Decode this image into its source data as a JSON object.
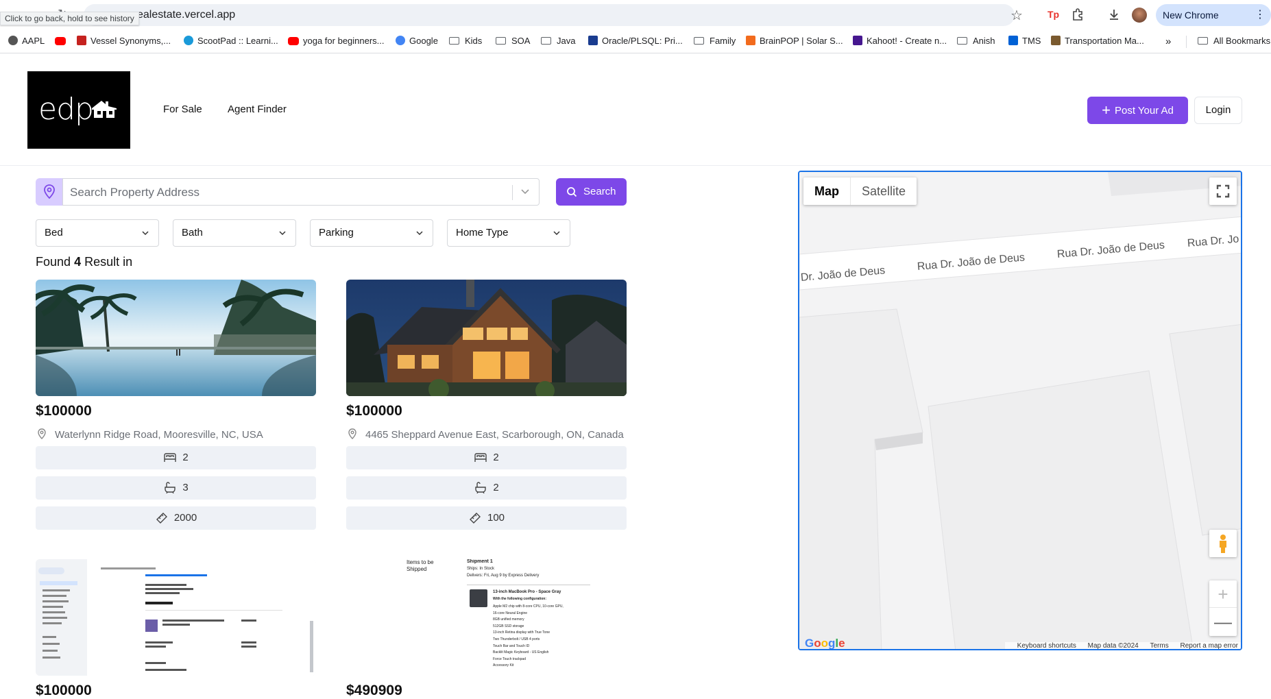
{
  "browser": {
    "url": "ealestate.vercel.app",
    "back_tooltip": "Click to go back, hold to see history",
    "new_chrome": "New Chrome available",
    "bookmarks": [
      {
        "label": "AAPL",
        "icon": "link-icon",
        "color": "#555555"
      },
      {
        "label": "",
        "icon": "youtube-icon",
        "color": "#ff0000"
      },
      {
        "label": "Vessel Synonyms,...",
        "icon": "thesaurus-icon",
        "color": "#c5221f"
      },
      {
        "label": "ScootPad :: Learni...",
        "icon": "scootpad-icon",
        "color": "#1a9ad9"
      },
      {
        "label": "yoga for beginners...",
        "icon": "youtube-icon",
        "color": "#ff0000"
      },
      {
        "label": "Google",
        "icon": "google-icon",
        "color": "#4285f4"
      },
      {
        "label": "Kids",
        "icon": "folder-icon"
      },
      {
        "label": "SOA",
        "icon": "folder-icon"
      },
      {
        "label": "Java",
        "icon": "folder-icon"
      },
      {
        "label": "Oracle/PLSQL: Pri...",
        "icon": "techonthenet-icon",
        "color": "#1a3c8f"
      },
      {
        "label": "Family",
        "icon": "folder-icon"
      },
      {
        "label": "BrainPOP | Solar S...",
        "icon": "brainpop-icon",
        "color": "#f26b1d"
      },
      {
        "label": "Kahoot! - Create n...",
        "icon": "kahoot-icon",
        "color": "#46178f"
      },
      {
        "label": "Anish",
        "icon": "folder-icon"
      },
      {
        "label": "TMS",
        "icon": "box-icon",
        "color": "#0061d5"
      },
      {
        "label": "Transportation Ma...",
        "icon": "transport-icon",
        "color": "#7a5a2f"
      }
    ],
    "all_bookmarks": "All Bookmarks"
  },
  "header": {
    "logo_text": "edp",
    "nav": [
      "For Sale",
      "Agent Finder"
    ],
    "post_ad": "Post Your Ad",
    "login": "Login"
  },
  "search": {
    "placeholder": "Search Property Address",
    "button": "Search"
  },
  "filters": [
    "Bed",
    "Bath",
    "Parking",
    "Home Type"
  ],
  "results": {
    "prefix": "Found",
    "count": "4",
    "suffix": "Result in"
  },
  "listings": [
    {
      "price": "$100000",
      "address": "Waterlynn Ridge Road, Mooresville, NC, USA",
      "beds": "2",
      "baths": "3",
      "area": "2000",
      "image": "resort-pool-palms"
    },
    {
      "price": "$100000",
      "address": "4465 Sheppard Avenue East, Scarborough, ON, Canada",
      "beds": "2",
      "baths": "2",
      "area": "100",
      "image": "wooden-house-night"
    },
    {
      "price": "$100000",
      "image": "email-screenshot"
    },
    {
      "price": "$490909",
      "image": "macbook-order-screenshot",
      "doc_text": [
        "Items to be Shipped",
        "Shipment 1",
        "Ships: In Stock",
        "Delivers: Fri, Aug 9 by Express Delivery",
        "13-inch MacBook Pro - Space Gray",
        "With the following configuration:",
        "Apple M2 chip with 8-core CPU, 10-core GPU,",
        "16-core Neural Engine",
        "8GB unified memory",
        "512GB SSD storage",
        "13-inch Retina display with True Tone",
        "Two Thunderbolt / USB 4 ports",
        "Touch Bar and Touch ID",
        "Backlit Magic Keyboard - US English",
        "Force Touch trackpad",
        "Accessory Kit"
      ]
    }
  ],
  "map": {
    "type_map": "Map",
    "type_satellite": "Satellite",
    "street_labels": [
      "Dr. João de Deus",
      "Rua Dr. João de Deus",
      "Rua Dr. João de Deus",
      "Rua Dr. Jo"
    ],
    "google": "Google",
    "footer": [
      "Keyboard shortcuts",
      "Map data ©2024",
      "Terms",
      "Report a map error"
    ]
  },
  "colors": {
    "accent": "#7d48e8",
    "map_border": "#1a73e8"
  }
}
